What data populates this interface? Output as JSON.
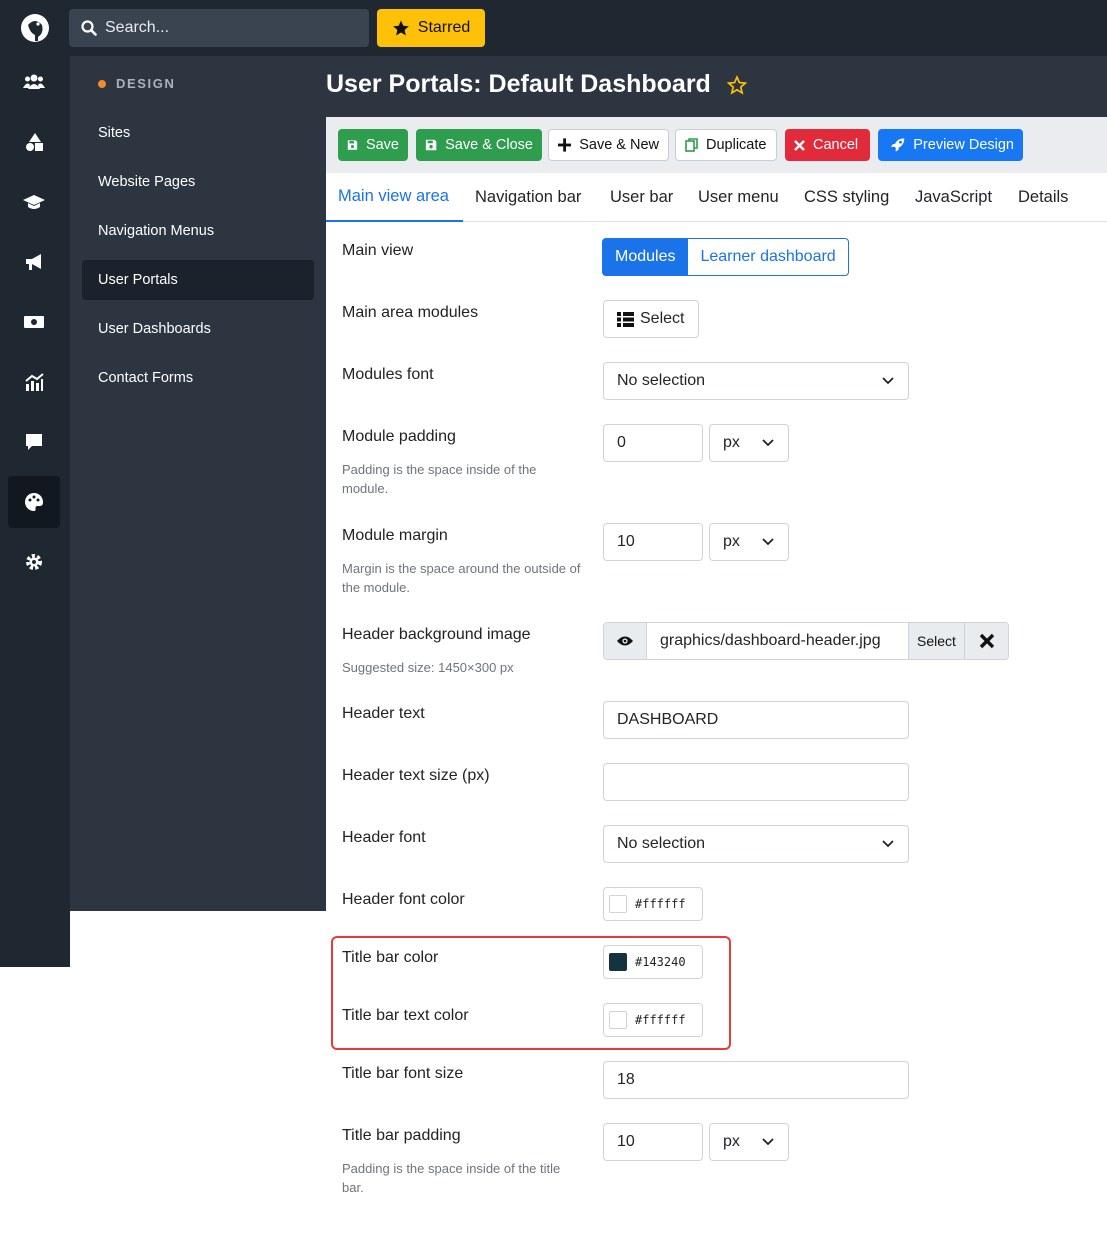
{
  "app": {
    "search_placeholder": "Search...",
    "starred_label": "Starred"
  },
  "rail": [
    "users-icon",
    "shapes-icon",
    "graduation-cap-icon",
    "megaphone-icon",
    "money-icon",
    "chart-icon",
    "chat-icon",
    "palette-icon",
    "gear-icon"
  ],
  "subnav": {
    "heading": "DESIGN",
    "items": [
      "Sites",
      "Website Pages",
      "Navigation Menus",
      "User Portals",
      "User Dashboards",
      "Contact Forms"
    ],
    "active": "User Portals"
  },
  "page": {
    "title": "User Portals: Default Dashboard"
  },
  "toolbar": {
    "save": "Save",
    "save_close": "Save & Close",
    "save_new": "Save & New",
    "duplicate": "Duplicate",
    "cancel": "Cancel",
    "preview": "Preview Design"
  },
  "tabs": [
    "Main view area",
    "Navigation bar",
    "User bar",
    "User menu",
    "CSS styling",
    "JavaScript",
    "Details"
  ],
  "form": {
    "main_view": {
      "label": "Main view",
      "options": [
        "Modules",
        "Learner dashboard"
      ],
      "selected": "Modules"
    },
    "main_area_modules": {
      "label": "Main area modules",
      "button": "Select"
    },
    "modules_font": {
      "label": "Modules font",
      "value": "No selection"
    },
    "module_padding": {
      "label": "Module padding",
      "help": "Padding is the space inside of the module.",
      "value": "0",
      "unit": "px"
    },
    "module_margin": {
      "label": "Module margin",
      "help": "Margin is the space around the outside of the module.",
      "value": "10",
      "unit": "px"
    },
    "header_bg_image": {
      "label": "Header background image",
      "help": "Suggested size: 1450×300 px",
      "value": "graphics/dashboard-header.jpg",
      "select": "Select"
    },
    "header_text": {
      "label": "Header text",
      "value": "DASHBOARD"
    },
    "header_text_size": {
      "label": "Header text size (px)",
      "value": ""
    },
    "header_font": {
      "label": "Header font",
      "value": "No selection"
    },
    "header_font_color": {
      "label": "Header font color",
      "value": "#ffffff",
      "swatch": "#ffffff"
    },
    "title_bar_color": {
      "label": "Title bar color",
      "value": "#143240",
      "swatch": "#143240"
    },
    "title_bar_text_color": {
      "label": "Title bar text color",
      "value": "#ffffff",
      "swatch": "#ffffff"
    },
    "title_bar_font_size": {
      "label": "Title bar font size",
      "value": "18"
    },
    "title_bar_padding": {
      "label": "Title bar padding",
      "help": "Padding is the space inside of the title bar.",
      "value": "10",
      "unit": "px"
    }
  },
  "colors": {
    "accent": "#1a73e8",
    "highlight": "#e53b3b",
    "starred": "#ffc107"
  }
}
